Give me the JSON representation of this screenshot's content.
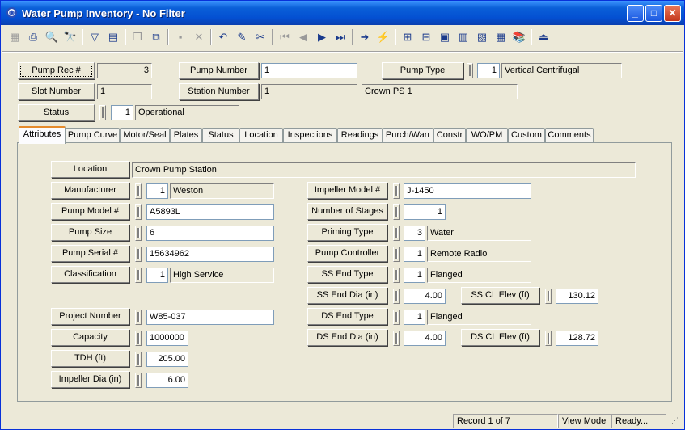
{
  "window": {
    "title": "Water Pump Inventory - No Filter",
    "minimize": "_",
    "maximize": "□",
    "close": "✕"
  },
  "toolbar": [
    {
      "name": "grid-view-icon",
      "glyph": "▦",
      "disabled": true
    },
    {
      "name": "print-icon",
      "glyph": "⎙"
    },
    {
      "name": "print-preview-icon",
      "glyph": "🔍"
    },
    {
      "name": "find-icon",
      "glyph": "🔭"
    },
    {
      "name": "filter-icon",
      "glyph": "▽"
    },
    {
      "name": "report-icon",
      "glyph": "▤"
    },
    {
      "name": "copy-record-icon",
      "glyph": "❐",
      "disabled": true
    },
    {
      "name": "duplicate-icon",
      "glyph": "⧉"
    },
    {
      "name": "save-icon",
      "glyph": "▪",
      "disabled": true
    },
    {
      "name": "delete-icon",
      "glyph": "✕",
      "disabled": true
    },
    {
      "name": "undo-icon",
      "glyph": "↶"
    },
    {
      "name": "edit-icon",
      "glyph": "✎"
    },
    {
      "name": "cut-icon",
      "glyph": "✂"
    },
    {
      "name": "first-record-icon",
      "glyph": "⏮",
      "disabled": true
    },
    {
      "name": "previous-record-icon",
      "glyph": "◀",
      "disabled": true
    },
    {
      "name": "next-record-icon",
      "glyph": "▶"
    },
    {
      "name": "last-record-icon",
      "glyph": "⏭"
    },
    {
      "name": "goto-icon",
      "glyph": "➜"
    },
    {
      "name": "lightning-icon",
      "glyph": "⚡"
    },
    {
      "name": "map-icon",
      "glyph": "⊞"
    },
    {
      "name": "tree-icon",
      "glyph": "⊟"
    },
    {
      "name": "chart-icon",
      "glyph": "▣"
    },
    {
      "name": "calculator-icon",
      "glyph": "▥"
    },
    {
      "name": "picture-icon",
      "glyph": "▧"
    },
    {
      "name": "table-icon",
      "glyph": "▦"
    },
    {
      "name": "books-icon",
      "glyph": "📚"
    },
    {
      "name": "exit-icon",
      "glyph": "⏏"
    }
  ],
  "header": {
    "pump_rec_label": "Pump Rec #",
    "pump_rec": "3",
    "pump_number_label": "Pump Number",
    "pump_number": "1",
    "pump_type_label": "Pump Type",
    "pump_type_code": "1",
    "pump_type": "Vertical Centrifugal",
    "slot_number_label": "Slot Number",
    "slot_number": "1",
    "station_number_label": "Station Number",
    "station_number": "1",
    "station_name": "Crown PS 1",
    "status_label": "Status",
    "status_code": "1",
    "status": "Operational"
  },
  "tabs": [
    "Attributes",
    "Pump Curve",
    "Motor/Seal",
    "Plates",
    "Status",
    "Location",
    "Inspections",
    "Readings",
    "Purch/Warr",
    "Constr",
    "WO/PM",
    "Custom",
    "Comments"
  ],
  "attributes": {
    "location_label": "Location",
    "location": "Crown Pump Station",
    "manufacturer_label": "Manufacturer",
    "manufacturer_code": "1",
    "manufacturer": "Weston",
    "pump_model_label": "Pump Model #",
    "pump_model": "A5893L",
    "pump_size_label": "Pump Size",
    "pump_size": "6",
    "pump_serial_label": "Pump Serial #",
    "pump_serial": "15634962",
    "classification_label": "Classification",
    "classification_code": "1",
    "classification": "High Service",
    "project_number_label": "Project Number",
    "project_number": "W85-037",
    "capacity_label": "Capacity",
    "capacity": "1000000",
    "tdh_label": "TDH (ft)",
    "tdh": "205.00",
    "impeller_dia_label": "Impeller Dia (in)",
    "impeller_dia": "6.00",
    "impeller_model_label": "Impeller Model #",
    "impeller_model": "J-1450",
    "stages_label": "Number of Stages",
    "stages": "1",
    "priming_label": "Priming Type",
    "priming_code": "3",
    "priming": "Water",
    "controller_label": "Pump Controller",
    "controller_code": "1",
    "controller": "Remote Radio",
    "ss_end_type_label": "SS End Type",
    "ss_end_type_code": "1",
    "ss_end_type": "Flanged",
    "ss_end_dia_label": "SS End Dia (in)",
    "ss_end_dia": "4.00",
    "ss_cl_elev_label": "SS CL Elev (ft)",
    "ss_cl_elev": "130.12",
    "ds_end_type_label": "DS End Type",
    "ds_end_type_code": "1",
    "ds_end_type": "Flanged",
    "ds_end_dia_label": "DS End Dia (in)",
    "ds_end_dia": "4.00",
    "ds_cl_elev_label": "DS CL Elev (ft)",
    "ds_cl_elev": "128.72"
  },
  "status": {
    "record": "Record 1 of 7",
    "mode": "View Mode",
    "state": "Ready..."
  }
}
